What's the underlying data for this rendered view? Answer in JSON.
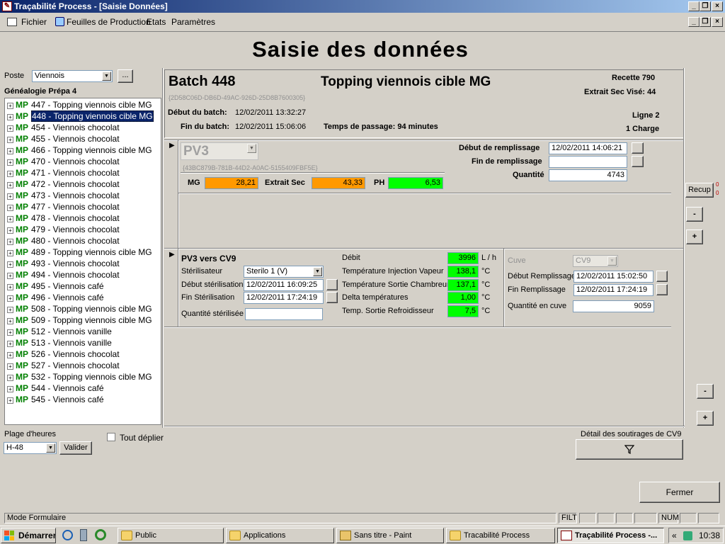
{
  "window": {
    "title": "Traçabilité Process - [Saisie Données]"
  },
  "menu": {
    "items": [
      "Fichier",
      "Feuilles de Production",
      "Etats",
      "Paramètres"
    ]
  },
  "page_title": "Saisie des données",
  "left": {
    "poste_label": "Poste",
    "poste_value": "Viennois",
    "poste_more": "...",
    "genealogie_label": "Généalogie Prépa 4",
    "tree_prefix": "MP",
    "tree": [
      "447 - Topping viennois cible MG",
      "448 - Topping viennois cible MG",
      "454 - Viennois chocolat",
      "455 - Viennois chocolat",
      "466 - Topping viennois cible MG",
      "470 - Viennois chocolat",
      "471 - Viennois chocolat",
      "472 - Viennois chocolat",
      "473 - Viennois chocolat",
      "477 - Viennois chocolat",
      "478 - Viennois chocolat",
      "479 - Viennois chocolat",
      "480 - Viennois chocolat",
      "489 - Topping viennois cible MG",
      "493 - Viennois chocolat",
      "494 - Viennois chocolat",
      "495 - Viennois café",
      "496 - Viennois café",
      "508 - Topping viennois cible MG",
      "509 - Topping viennois cible MG",
      "512 - Viennois vanille",
      "513 - Viennois vanille",
      "526 - Viennois chocolat",
      "527 - Viennois chocolat",
      "532 - Topping viennois cible MG",
      "544 - Viennois café",
      "545 - Viennois café"
    ],
    "selected_index": 1,
    "plage_label": "Plage d'heures",
    "plage_value": "H-48",
    "valider": "Valider",
    "tout_deplier": "Tout déplier"
  },
  "batch": {
    "title": "Batch 448",
    "product": "Topping viennois cible MG",
    "guid": "{2D58C06D-DB6D-49AC-926D-25D8B7600305}",
    "recette": "Recette 790",
    "extrait_sec_vise": "Extrait Sec Visé: 44",
    "debut_label": "Début du batch:",
    "debut_value": "12/02/2011 13:32:27",
    "fin_label": "Fin du batch:",
    "fin_value": "12/02/2011 15:06:06",
    "temps_passage": "Temps de passage: 94 minutes",
    "ligne": "Ligne 2",
    "charge": "1 Charge"
  },
  "pv": {
    "name": "PV3",
    "guid": "{43BC879B-781B-44D2-A0AC-5155409FBF5E}",
    "mg_label": "MG",
    "mg_value": "28,21",
    "es_label": "Extrait Sec",
    "es_value": "43,33",
    "ph_label": "PH",
    "ph_value": "6,53",
    "debut_remp_label": "Début de remplissage",
    "debut_remp_value": "12/02/2011 14:06:21",
    "fin_remp_label": "Fin de remplissage",
    "fin_remp_value": "",
    "quantite_label": "Quantité",
    "quantite_value": "4743"
  },
  "side_buttons": {
    "recup": "Recup",
    "minus": "-",
    "plus": "+",
    "recup_flags": [
      "0",
      "0"
    ]
  },
  "transfer": {
    "title": "PV3 vers CV9",
    "sterilisateur_label": "Stérilisateur",
    "sterilisateur_value": "Sterilo 1 (V)",
    "debut_ster_label": "Début stérilisation",
    "debut_ster_value": "12/02/2011 16:09:25",
    "fin_ster_label": "Fin Stérilisation",
    "fin_ster_value": "12/02/2011 17:24:19",
    "qte_ster_label": "Quantité stérilisée",
    "qte_ster_value": "",
    "debit_label": "Débit",
    "debit_value": "3996",
    "debit_unit": "L / h",
    "t_inj_label": "Température Injection Vapeur",
    "t_inj_value": "138,1",
    "t_sortie_label": "Température Sortie Chambreur",
    "t_sortie_value": "137,1",
    "delta_label": "Delta températures",
    "delta_value": "1,00",
    "t_refr_label": "Temp. Sortie Refroidisseur",
    "t_refr_value": "7,5",
    "deg_unit": "°C",
    "cuve_label": "Cuve",
    "cuve_value": "CV9",
    "debut_remp_label": "Début Remplissage",
    "debut_remp_value": "12/02/2011 15:02:50",
    "fin_remp_label": "Fin Remplissage",
    "fin_remp_value": "12/02/2011 17:24:19",
    "qte_cuve_label": "Quantité en cuve",
    "qte_cuve_value": "9059"
  },
  "soutirages": {
    "label": "Détail des soutirages de CV9"
  },
  "fermer": "Fermer",
  "status": {
    "mode": "Mode Formulaire",
    "filt": "FILT",
    "num": "NUM"
  },
  "taskbar": {
    "start": "Démarrer",
    "items": [
      "Public",
      "Applications",
      "Sans titre - Paint",
      "Tracabilité Process",
      "Traçabilité Process -..."
    ],
    "clock": "10:38",
    "chevron": "«"
  }
}
